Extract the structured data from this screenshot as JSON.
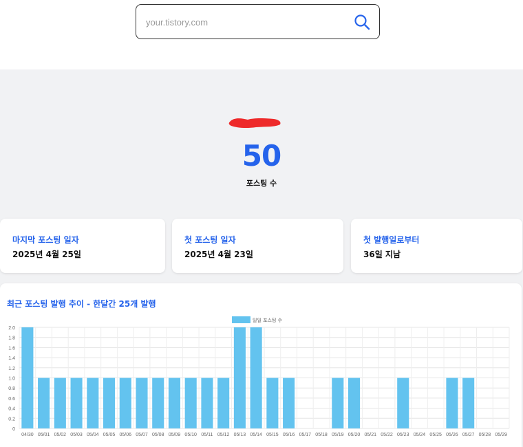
{
  "search": {
    "placeholder": "your.tistory.com",
    "icon": "search-icon"
  },
  "blog": {
    "post_count": "50",
    "post_count_label": "포스팅 수"
  },
  "cards": [
    {
      "title": "마지막 포스팅 일자",
      "value": "2025년 4월 25일"
    },
    {
      "title": "첫 포스팅 일자",
      "value": "2025년 4월 23일"
    },
    {
      "title": "첫 발행일로부터",
      "value": "36일 지남"
    }
  ],
  "chart": {
    "title": "최근 포스팅 발행 추이 - 한달간 25개 발행"
  },
  "colors": {
    "accent": "#2563eb",
    "bar": "#63c3ef",
    "band": "#f1f2f4"
  },
  "chart_data": {
    "type": "bar",
    "categories": [
      "04/30",
      "05/01",
      "05/02",
      "05/03",
      "05/04",
      "05/05",
      "05/06",
      "05/07",
      "05/08",
      "05/09",
      "05/10",
      "05/11",
      "05/12",
      "05/13",
      "05/14",
      "05/15",
      "05/16",
      "05/17",
      "05/18",
      "05/19",
      "05/20",
      "05/21",
      "05/22",
      "05/23",
      "05/24",
      "05/25",
      "05/26",
      "05/27",
      "05/28",
      "05/29"
    ],
    "series": [
      {
        "name": "일일 포스팅 수",
        "values": [
          2,
          1,
          1,
          1,
          1,
          1,
          1,
          1,
          1,
          1,
          1,
          1,
          1,
          2,
          2,
          1,
          1,
          0,
          0,
          1,
          1,
          0,
          0,
          1,
          0,
          0,
          1,
          1,
          0,
          0
        ]
      }
    ],
    "ylim": [
      0,
      2
    ],
    "yticks": [
      "0",
      "0.2",
      "0.4",
      "0.6",
      "0.8",
      "1.0",
      "1.2",
      "1.4",
      "1.6",
      "1.8",
      "2.0"
    ],
    "grid": true,
    "legend": "top-center"
  }
}
